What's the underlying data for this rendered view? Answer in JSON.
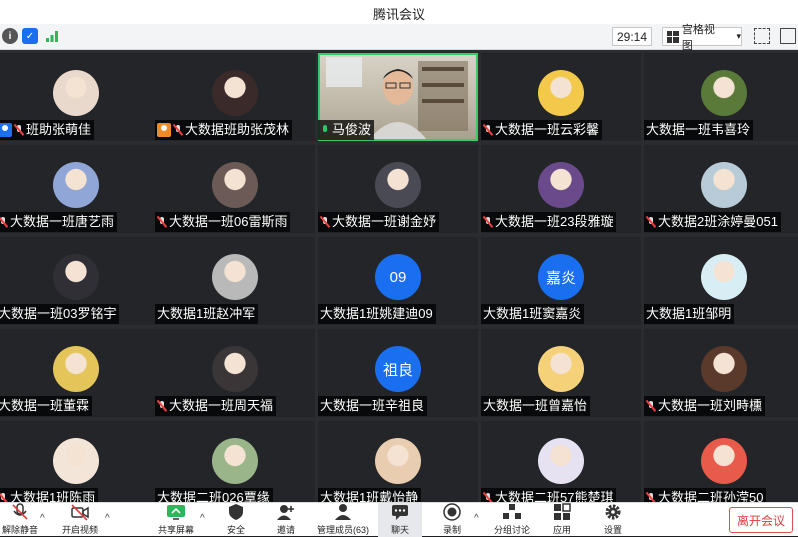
{
  "app": {
    "title": "腾讯会议"
  },
  "toolbar": {
    "timer": "29:14",
    "view_label": "宫格视图",
    "view_caret": "▾"
  },
  "nav": {
    "prev": "❮",
    "next": "❯"
  },
  "participants": [
    {
      "name": "班助张萌佳",
      "badge": "host",
      "mic": "off",
      "avatar_type": "photo",
      "avatar_color": "#e9d9cc"
    },
    {
      "name": "大数据班助张茂林",
      "badge": "cohost",
      "mic": "off",
      "avatar_type": "photo",
      "avatar_color": "#3a2a2a"
    },
    {
      "name": "马俊波",
      "badge": "",
      "mic": "on",
      "avatar_type": "video",
      "avatar_color": "#c8c2b4"
    },
    {
      "name": "大数据一班云彩馨",
      "badge": "",
      "mic": "off",
      "avatar_type": "photo",
      "avatar_color": "#f2c94a"
    },
    {
      "name": "大数据一班韦喜玲",
      "badge": "",
      "mic": "",
      "avatar_type": "photo",
      "avatar_color": "#5a7a3a"
    },
    {
      "name": "大数据一班唐艺雨",
      "badge": "",
      "mic": "off",
      "avatar_type": "photo",
      "avatar_color": "#8fa6d6"
    },
    {
      "name": "大数据一班06雷斯雨",
      "badge": "",
      "mic": "off",
      "avatar_type": "photo",
      "avatar_color": "#6b5a55"
    },
    {
      "name": "大数据一班谢金妤",
      "badge": "",
      "mic": "off",
      "avatar_type": "photo",
      "avatar_color": "#4a4a55"
    },
    {
      "name": "大数据一班23段雅璇",
      "badge": "",
      "mic": "off",
      "avatar_type": "photo",
      "avatar_color": "#6a4a8a"
    },
    {
      "name": "大数据2班涂婷曼051",
      "badge": "",
      "mic": "off",
      "avatar_type": "photo",
      "avatar_color": "#b8ccd8"
    },
    {
      "name": "大数据一班03罗铭宇",
      "badge": "",
      "mic": "",
      "avatar_type": "photo",
      "avatar_color": "#2f2f35"
    },
    {
      "name": "大数据1班赵冲军",
      "badge": "",
      "mic": "",
      "avatar_type": "photo",
      "avatar_color": "#b9b9b9"
    },
    {
      "name": "大数据1班姚建迪09",
      "badge": "",
      "mic": "",
      "avatar_type": "text",
      "avatar_text": "09",
      "avatar_color": "#1a6ff0"
    },
    {
      "name": "大数据1班窦嘉炎",
      "badge": "",
      "mic": "",
      "avatar_type": "text",
      "avatar_text": "嘉炎",
      "avatar_color": "#1a6ff0"
    },
    {
      "name": "大数据1班邹明",
      "badge": "",
      "mic": "",
      "avatar_type": "photo",
      "avatar_color": "#d8eef5"
    },
    {
      "name": "大数据一班董霖",
      "badge": "",
      "mic": "",
      "avatar_type": "photo",
      "avatar_color": "#e4c55a"
    },
    {
      "name": "大数据一班周天福",
      "badge": "",
      "mic": "off",
      "avatar_type": "photo",
      "avatar_color": "#3a3536"
    },
    {
      "name": "大数据一班辛祖良",
      "badge": "",
      "mic": "",
      "avatar_type": "text",
      "avatar_text": "祖良",
      "avatar_color": "#1a6ff0"
    },
    {
      "name": "大数据一班曾嘉怡",
      "badge": "",
      "mic": "",
      "avatar_type": "photo",
      "avatar_color": "#f5d27a"
    },
    {
      "name": "大数据一班刘畤櫄",
      "badge": "",
      "mic": "off",
      "avatar_type": "photo",
      "avatar_color": "#5a3a2a"
    },
    {
      "name": "大数据1班陈雨",
      "badge": "",
      "mic": "off",
      "avatar_type": "photo",
      "avatar_color": "#f3e6d8"
    },
    {
      "name": "大数据二班026覃缘",
      "badge": "",
      "mic": "",
      "avatar_type": "photo",
      "avatar_color": "#9ab58a"
    },
    {
      "name": "大数据1班戴怡静",
      "badge": "",
      "mic": "",
      "avatar_type": "photo",
      "avatar_color": "#e8cdb0"
    },
    {
      "name": "大数据二班57熊楚琪",
      "badge": "",
      "mic": "off",
      "avatar_type": "photo",
      "avatar_color": "#e6e2f2"
    },
    {
      "name": "大数据二班孙滢50",
      "badge": "",
      "mic": "off",
      "avatar_type": "photo",
      "avatar_color": "#e85a4a"
    }
  ],
  "bottombar": {
    "unmute": "解除静音",
    "start_video": "开启视频",
    "share_screen": "共享屏幕",
    "security": "安全",
    "invite": "邀请",
    "manage_members": "管理成员(63)",
    "chat": "聊天",
    "record": "录制",
    "breakout": "分组讨论",
    "apps": "应用",
    "settings": "设置",
    "leave": "离开会议",
    "caret": "^"
  }
}
